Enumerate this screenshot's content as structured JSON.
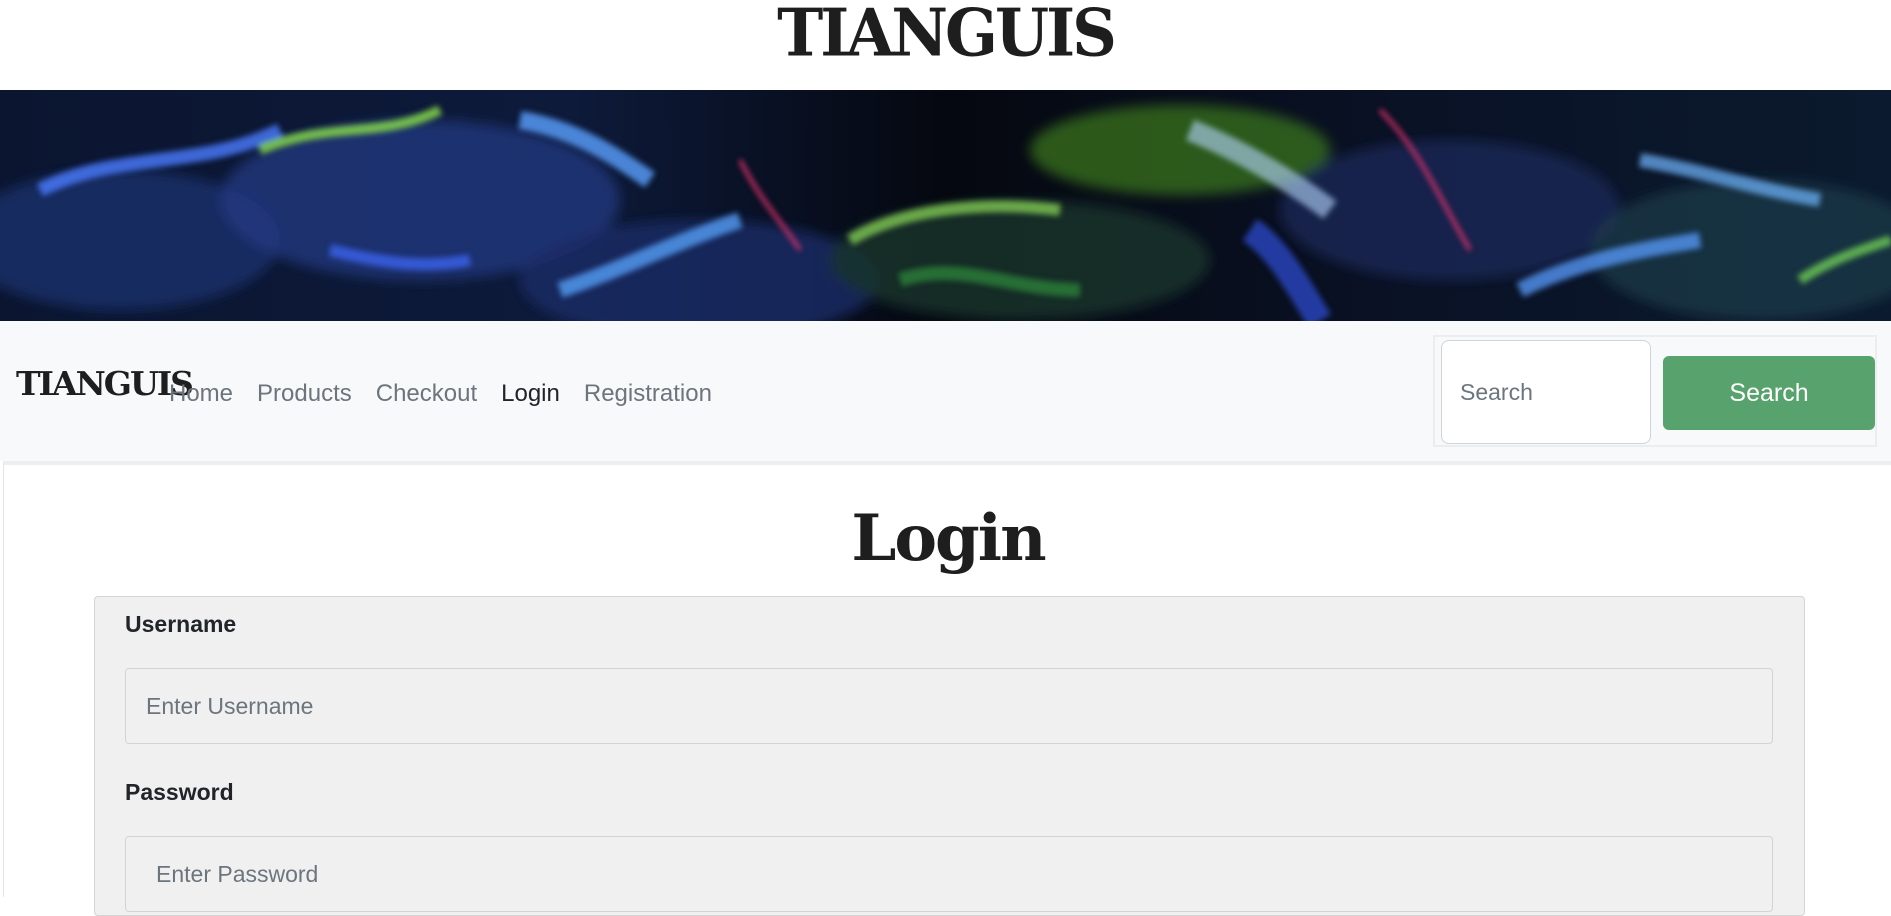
{
  "site": {
    "logo_text": "TIANGUIS"
  },
  "banner": {
    "alt": "abstract iridescent banner"
  },
  "navbar": {
    "brand": "TIANGUIS",
    "links": [
      {
        "label": "Home",
        "active": false
      },
      {
        "label": "Products",
        "active": false
      },
      {
        "label": "Checkout",
        "active": false
      },
      {
        "label": "Login",
        "active": true
      },
      {
        "label": "Registration",
        "active": false
      }
    ],
    "search": {
      "placeholder": "Search",
      "button_label": "Search"
    }
  },
  "main": {
    "title": "Login",
    "form": {
      "username_label": "Username",
      "username_placeholder": "Enter Username",
      "password_label": "Password",
      "password_placeholder": "Enter Password"
    }
  },
  "colors": {
    "search_button": "#58a36d",
    "navbar_bg": "#f8f9fa",
    "card_bg": "#f0f0f0",
    "link_muted": "#6c757d",
    "link_active": "#212529"
  }
}
